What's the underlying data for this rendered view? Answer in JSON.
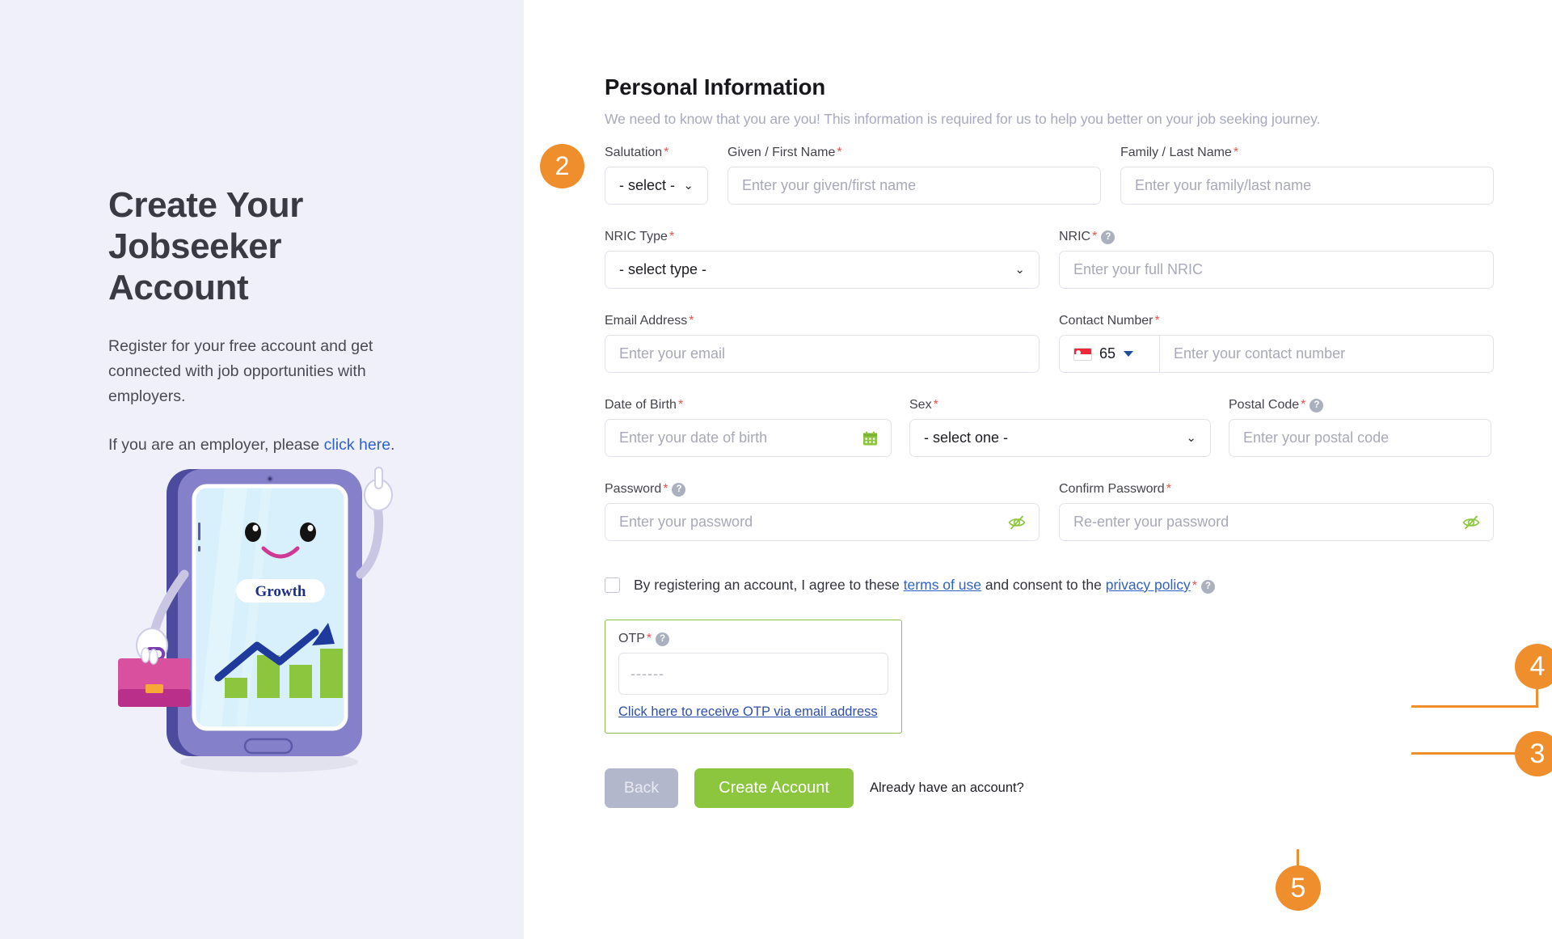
{
  "left": {
    "title": "Create Your Jobseeker Account",
    "paragraph1": "Register for your free account and get connected with job opportunities with employers.",
    "paragraph2_prefix": "If you are an employer, please ",
    "paragraph2_link": "click here",
    "paragraph2_suffix": ".",
    "illustration": {
      "screen_label": "Growth",
      "bars": [
        1,
        2,
        1.6,
        2.6
      ]
    },
    "colors": {
      "background": "#F0F0FB",
      "title_text": "#3A3A45",
      "link": "#2F62C7"
    }
  },
  "form": {
    "title": "Personal Information",
    "subtitle": "We need to know that you are you! This information is required for us to help you better on your job seeking journey.",
    "fields": {
      "salutation": {
        "label": "Salutation",
        "required": "*",
        "value": "- select -"
      },
      "given_name": {
        "label": "Given / First Name",
        "required": "*",
        "placeholder": "Enter your given/first name"
      },
      "family_name": {
        "label": "Family / Last Name",
        "required": "*",
        "placeholder": "Enter your family/last name"
      },
      "nric_type": {
        "label": "NRIC Type",
        "required": "*",
        "value": "- select type -"
      },
      "nric": {
        "label": "NRIC",
        "required": "*",
        "help": "?",
        "placeholder": "Enter your full NRIC"
      },
      "email": {
        "label": "Email Address",
        "required": "*",
        "placeholder": "Enter your email"
      },
      "contact": {
        "label": "Contact Number",
        "required": "*",
        "country_code": "65",
        "placeholder": "Enter your contact number"
      },
      "dob": {
        "label": "Date of Birth",
        "required": "*",
        "placeholder": "Enter your date of birth"
      },
      "sex": {
        "label": "Sex",
        "required": "*",
        "value": "- select one -"
      },
      "postal": {
        "label": "Postal Code",
        "required": "*",
        "help": "?",
        "placeholder": "Enter your postal code"
      },
      "password": {
        "label": "Password",
        "required": "*",
        "help": "?",
        "placeholder": "Enter your password"
      },
      "confirm_password": {
        "label": "Confirm Password",
        "required": "*",
        "placeholder": "Re-enter your password"
      },
      "otp": {
        "label": "OTP",
        "required": "*",
        "help": "?",
        "placeholder": "------"
      }
    },
    "terms": {
      "text_before": "By registering an account, I agree to these",
      "link_terms": "terms of use",
      "text_middle": "and consent to the",
      "link_privacy": "privacy policy",
      "required": "*",
      "help": "?"
    },
    "otp_link": "Click here to receive OTP via email address",
    "buttons": {
      "back": "Back",
      "create": "Create Account",
      "already": "Already have an account?"
    },
    "colors": {
      "primary_button": "#8CC63E",
      "back_button": "#B3B7CC",
      "required_star": "#E8544D",
      "otp_panel_border": "#8CC152",
      "input_border": "#E2E3EA"
    }
  },
  "annotations": {
    "step2": "2",
    "step3": "3",
    "step4": "4",
    "step5": "5",
    "color": "#EF8E2C"
  }
}
